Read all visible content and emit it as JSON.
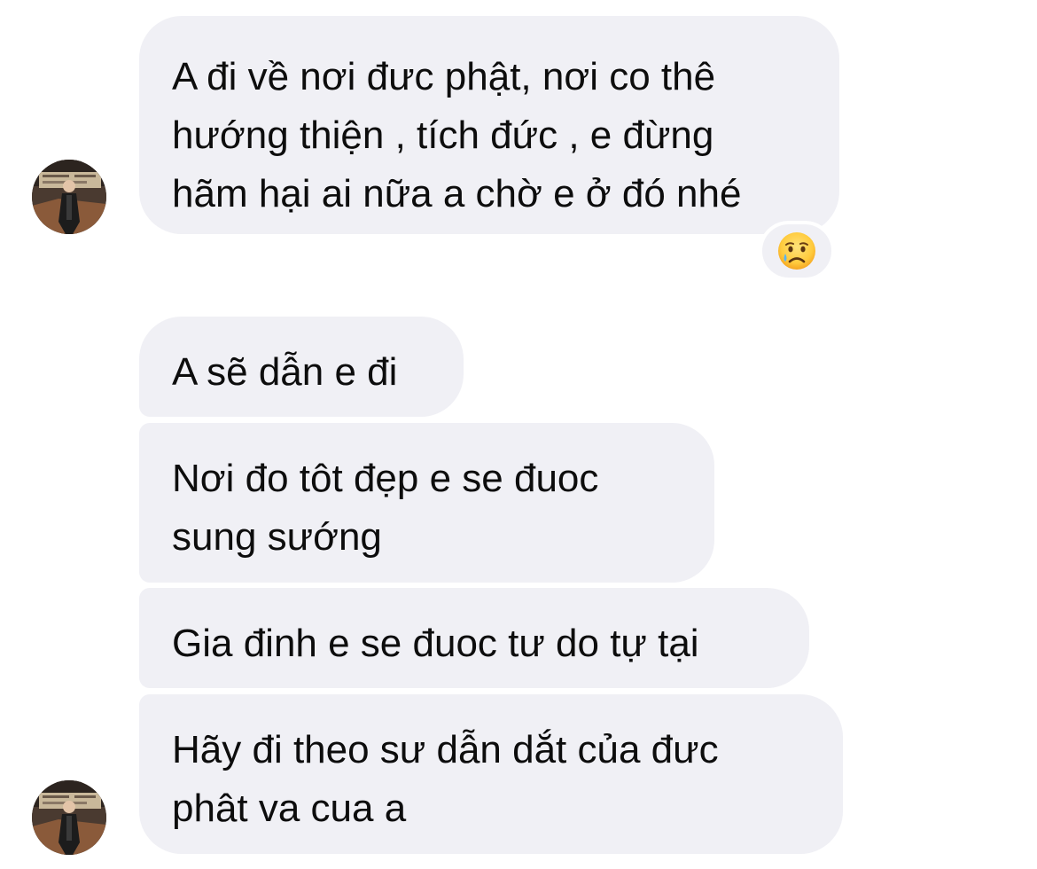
{
  "conversation": {
    "messages": [
      {
        "lines": [
          "A đi về nơi đưc phật, nơi co thê",
          "hướng thiện , tích đức , e đừng",
          "hãm hại ai nữa a chờ e ở đó nhé"
        ]
      },
      {
        "lines": [
          "A sẽ dẫn e đi"
        ]
      },
      {
        "lines": [
          "Nơi đo tôt đẹp e se đuoc",
          "sung sướng"
        ]
      },
      {
        "lines": [
          "Gia đinh e se đuoc tư do tự tại"
        ]
      },
      {
        "lines": [
          "Hãy đi theo sư dẫn dắt của đưc",
          "phât va cua a"
        ]
      }
    ],
    "reaction": {
      "icon": "crying-face-emoji"
    },
    "avatar": {
      "icon": "contact-avatar-photo"
    },
    "colors": {
      "bubble_background": "#f0f0f5",
      "text": "#0d0d0d",
      "page_background": "#ffffff"
    }
  }
}
